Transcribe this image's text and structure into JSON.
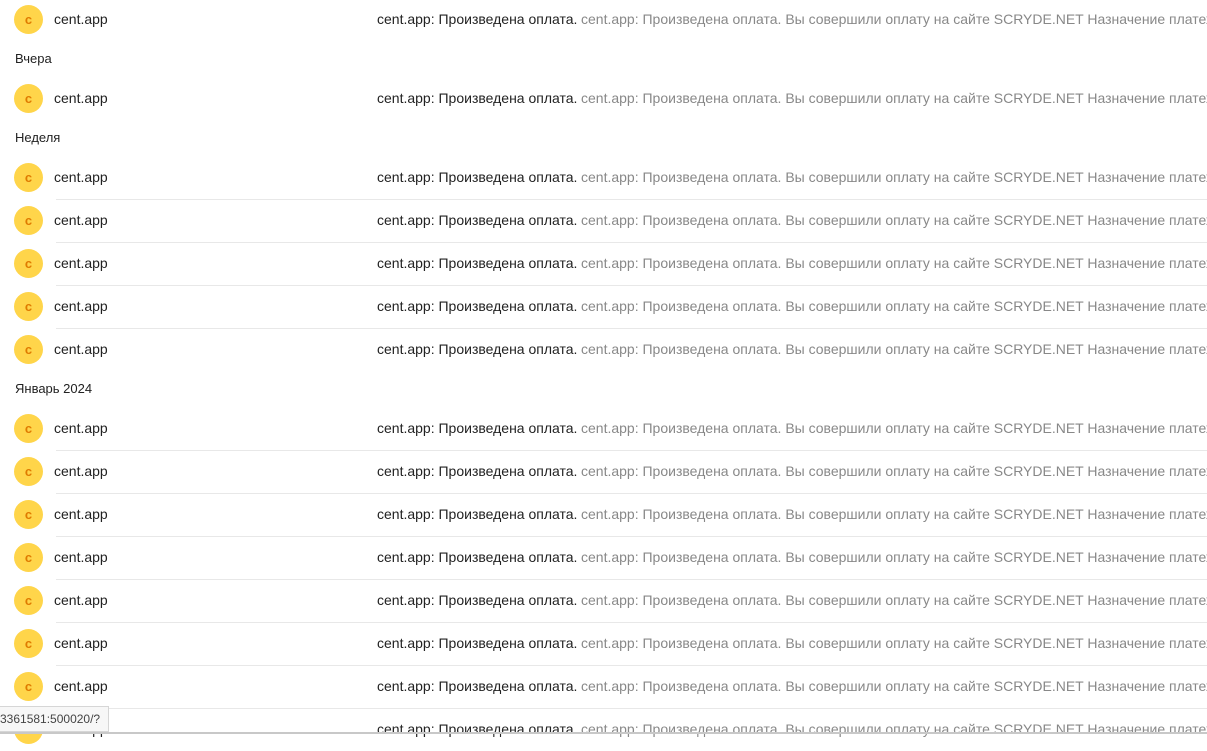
{
  "groups": [
    {
      "header": "",
      "rows": 1
    },
    {
      "header": "Вчера",
      "rows": 1
    },
    {
      "header": "Неделя",
      "rows": 5
    },
    {
      "header": "Январь 2024",
      "rows": 8
    }
  ],
  "message": {
    "avatar_letter": "c",
    "sender": "cent.app",
    "subject": "cent.app: Произведена оплата.",
    "snippet": "cent.app: Произведена оплата. Вы совершили оплату на сайте SCRYDE.NET Назначение платежа Б"
  },
  "status_bar_url": "3361581:500020/?",
  "colors": {
    "avatar_bg": "#ffd54a",
    "avatar_letter": "#e07b00",
    "snippet": "#888888",
    "separator": "#e8e8e8"
  }
}
